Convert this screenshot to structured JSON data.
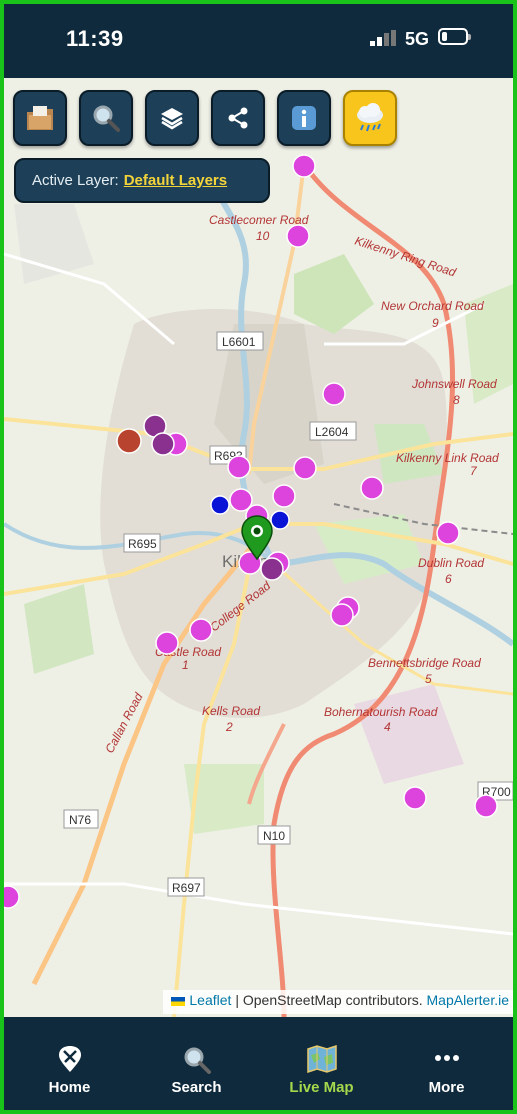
{
  "status_bar": {
    "time": "11:39",
    "network": "5G"
  },
  "toolbar": {
    "buttons": [
      {
        "id": "folder",
        "icon": "folder-icon"
      },
      {
        "id": "search",
        "icon": "magnifier-icon"
      },
      {
        "id": "layers",
        "icon": "layers-icon"
      },
      {
        "id": "share",
        "icon": "share-icon"
      },
      {
        "id": "info",
        "icon": "info-icon"
      },
      {
        "id": "weather",
        "icon": "rain-cloud-icon"
      }
    ]
  },
  "active_layer": {
    "label": "Active Layer:",
    "value": "Default Layers"
  },
  "map": {
    "town": "Kilkenny",
    "road_labels": [
      "Castlecomer Road",
      "10",
      "Kilkenny Ring Road",
      "New Orchard Road",
      "9",
      "Johnswell Road",
      "8",
      "Kilkenny Link Road",
      "7",
      "Dublin Road",
      "6",
      "Bennettsbridge Road",
      "5",
      "Bohernatourish Road",
      "4",
      "Kells Road",
      "2",
      "Callan Road",
      "College Road",
      "Castle Road",
      "1"
    ],
    "route_shields": [
      "L6601",
      "L2604",
      "R693",
      "R695",
      "N76",
      "R697",
      "N10",
      "R700"
    ]
  },
  "attribution": {
    "leaflet": "Leaflet",
    "separator": " | ",
    "osm": "OpenStreetMap contributors.",
    "mapalerter": "MapAlerter.ie"
  },
  "tabs": [
    {
      "label": "Home",
      "icon": "home-pin-icon",
      "active": false
    },
    {
      "label": "Search",
      "icon": "search-icon",
      "active": false
    },
    {
      "label": "Live Map",
      "icon": "map-icon",
      "active": true
    },
    {
      "label": "More",
      "icon": "more-dots-icon",
      "active": false
    }
  ],
  "colors": {
    "marker_magenta": "#dd44dd",
    "marker_purple": "#8a3190",
    "marker_blue": "#0a14d6",
    "marker_red": "#b8432e",
    "marker_green_pin": "#1f9a1f",
    "active_tab": "#a6d84b",
    "header": "#0e2a3c"
  }
}
